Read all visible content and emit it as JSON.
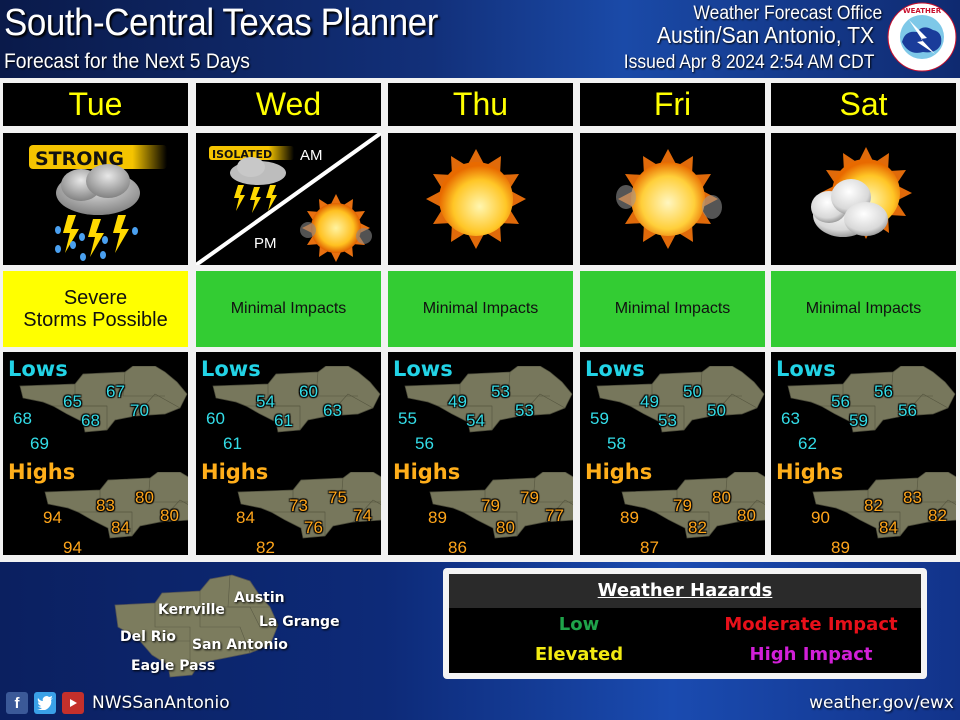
{
  "header": {
    "title": "South-Central Texas Planner",
    "subtitle": "Forecast for the Next 5 Days",
    "office_line1": "Weather Forecast Office",
    "office_line2": "Austin/San Antonio, TX",
    "issued": "Issued Apr 8 2024 2:54 AM CDT",
    "logo": "nws-logo-icon"
  },
  "labels": {
    "lows": "Lows",
    "highs": "Highs"
  },
  "days": [
    {
      "name": "Tue",
      "icon": "strong-thunderstorm-icon",
      "badge": "STRONG",
      "impact": "Severe Storms Possible",
      "impact_line1": "Severe",
      "impact_line2": "Storms Possible",
      "impact_level": "Elevated",
      "impact_color": "#ffff00",
      "lows": [
        "68",
        "65",
        "67",
        "68",
        "70",
        "69"
      ],
      "highs": [
        "94",
        "83",
        "80",
        "84",
        "80",
        "94"
      ]
    },
    {
      "name": "Wed",
      "icon": "isolated-thunderstorm-am-sunny-pm-icon",
      "badge": "ISOLATED",
      "am_label": "AM",
      "pm_label": "PM",
      "impact": "Minimal Impacts",
      "impact_level": "Low",
      "impact_color": "#33cc33",
      "lows": [
        "60",
        "54",
        "60",
        "61",
        "63",
        "61"
      ],
      "highs": [
        "84",
        "73",
        "75",
        "76",
        "74",
        "82"
      ]
    },
    {
      "name": "Thu",
      "icon": "sunny-icon",
      "impact": "Minimal Impacts",
      "impact_level": "Low",
      "impact_color": "#33cc33",
      "lows": [
        "55",
        "49",
        "53",
        "54",
        "53",
        "56"
      ],
      "highs": [
        "89",
        "79",
        "79",
        "80",
        "77",
        "86"
      ]
    },
    {
      "name": "Fri",
      "icon": "mostly-sunny-icon",
      "impact": "Minimal Impacts",
      "impact_level": "Low",
      "impact_color": "#33cc33",
      "lows": [
        "59",
        "49",
        "50",
        "53",
        "50",
        "58"
      ],
      "highs": [
        "89",
        "79",
        "80",
        "82",
        "80",
        "87"
      ]
    },
    {
      "name": "Sat",
      "icon": "partly-cloudy-icon",
      "impact": "Minimal Impacts",
      "impact_level": "Low",
      "impact_color": "#33cc33",
      "lows": [
        "63",
        "56",
        "56",
        "59",
        "56",
        "62"
      ],
      "highs": [
        "90",
        "82",
        "83",
        "84",
        "82",
        "89"
      ]
    }
  ],
  "reference_map": {
    "cities": [
      "Austin",
      "Kerrville",
      "La Grange",
      "Del Rio",
      "San Antonio",
      "Eagle Pass"
    ]
  },
  "social": {
    "icons": [
      "facebook-icon",
      "twitter-icon",
      "youtube-icon"
    ],
    "handle": "NWSSanAntonio"
  },
  "hazards": {
    "title": "Weather Hazards",
    "levels": [
      {
        "label": "Low",
        "color": "#1fa34a"
      },
      {
        "label": "Moderate Impact",
        "color": "#e8101a"
      },
      {
        "label": "Elevated",
        "color": "#f2ea12"
      },
      {
        "label": "High Impact",
        "color": "#d21fd8"
      }
    ]
  },
  "footer_url": "weather.gov/ewx"
}
